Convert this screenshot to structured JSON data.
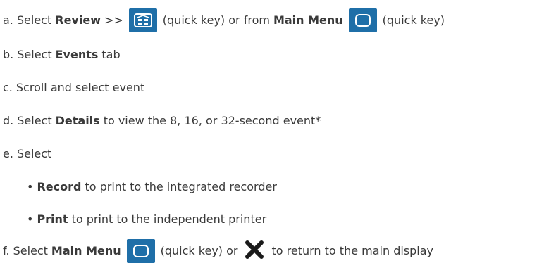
{
  "steps": {
    "a": {
      "marker": "a.",
      "t1": "Select",
      "b1": "Review",
      "t2": ">>",
      "t3": "(quick key) or from",
      "b2": "Main Menu",
      "t4": "(quick key)"
    },
    "b": {
      "marker": "b.",
      "t1": "Select",
      "b1": "Events",
      "t2": "tab"
    },
    "c": {
      "marker": "c.",
      "t1": "Scroll and select event"
    },
    "d": {
      "marker": "d.",
      "t1": "Select",
      "b1": "Details",
      "t2": "to view the 8, 16, or 32-second event*"
    },
    "e": {
      "marker": "e.",
      "t1": "Select",
      "sub": [
        {
          "bullet": "•",
          "b1": "Record",
          "t1": "to print to the integrated recorder"
        },
        {
          "bullet": "•",
          "b1": "Print",
          "t1": "to print to the independent printer"
        }
      ]
    },
    "f": {
      "marker": "f.",
      "t1": "Select",
      "b1": "Main Menu",
      "t2": "(quick key) or",
      "t3": "to return to the main display"
    }
  },
  "icons": {
    "review": "review-quick-key-icon",
    "main_menu": "main-menu-quick-key-icon",
    "close": "close-x-icon"
  },
  "colors": {
    "quick_key_bg": "#1f6fa8",
    "text": "#3a3a3a"
  }
}
